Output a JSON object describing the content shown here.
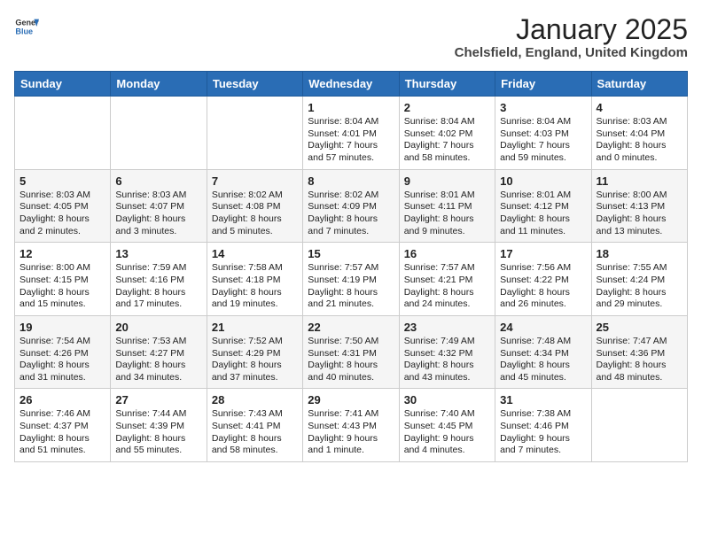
{
  "header": {
    "logo_general": "General",
    "logo_blue": "Blue",
    "title": "January 2025",
    "subtitle": "Chelsfield, England, United Kingdom"
  },
  "calendar": {
    "days_of_week": [
      "Sunday",
      "Monday",
      "Tuesday",
      "Wednesday",
      "Thursday",
      "Friday",
      "Saturday"
    ],
    "weeks": [
      [
        {
          "day": "",
          "content": ""
        },
        {
          "day": "",
          "content": ""
        },
        {
          "day": "",
          "content": ""
        },
        {
          "day": "1",
          "content": "Sunrise: 8:04 AM\nSunset: 4:01 PM\nDaylight: 7 hours and 57 minutes."
        },
        {
          "day": "2",
          "content": "Sunrise: 8:04 AM\nSunset: 4:02 PM\nDaylight: 7 hours and 58 minutes."
        },
        {
          "day": "3",
          "content": "Sunrise: 8:04 AM\nSunset: 4:03 PM\nDaylight: 7 hours and 59 minutes."
        },
        {
          "day": "4",
          "content": "Sunrise: 8:03 AM\nSunset: 4:04 PM\nDaylight: 8 hours and 0 minutes."
        }
      ],
      [
        {
          "day": "5",
          "content": "Sunrise: 8:03 AM\nSunset: 4:05 PM\nDaylight: 8 hours and 2 minutes."
        },
        {
          "day": "6",
          "content": "Sunrise: 8:03 AM\nSunset: 4:07 PM\nDaylight: 8 hours and 3 minutes."
        },
        {
          "day": "7",
          "content": "Sunrise: 8:02 AM\nSunset: 4:08 PM\nDaylight: 8 hours and 5 minutes."
        },
        {
          "day": "8",
          "content": "Sunrise: 8:02 AM\nSunset: 4:09 PM\nDaylight: 8 hours and 7 minutes."
        },
        {
          "day": "9",
          "content": "Sunrise: 8:01 AM\nSunset: 4:11 PM\nDaylight: 8 hours and 9 minutes."
        },
        {
          "day": "10",
          "content": "Sunrise: 8:01 AM\nSunset: 4:12 PM\nDaylight: 8 hours and 11 minutes."
        },
        {
          "day": "11",
          "content": "Sunrise: 8:00 AM\nSunset: 4:13 PM\nDaylight: 8 hours and 13 minutes."
        }
      ],
      [
        {
          "day": "12",
          "content": "Sunrise: 8:00 AM\nSunset: 4:15 PM\nDaylight: 8 hours and 15 minutes."
        },
        {
          "day": "13",
          "content": "Sunrise: 7:59 AM\nSunset: 4:16 PM\nDaylight: 8 hours and 17 minutes."
        },
        {
          "day": "14",
          "content": "Sunrise: 7:58 AM\nSunset: 4:18 PM\nDaylight: 8 hours and 19 minutes."
        },
        {
          "day": "15",
          "content": "Sunrise: 7:57 AM\nSunset: 4:19 PM\nDaylight: 8 hours and 21 minutes."
        },
        {
          "day": "16",
          "content": "Sunrise: 7:57 AM\nSunset: 4:21 PM\nDaylight: 8 hours and 24 minutes."
        },
        {
          "day": "17",
          "content": "Sunrise: 7:56 AM\nSunset: 4:22 PM\nDaylight: 8 hours and 26 minutes."
        },
        {
          "day": "18",
          "content": "Sunrise: 7:55 AM\nSunset: 4:24 PM\nDaylight: 8 hours and 29 minutes."
        }
      ],
      [
        {
          "day": "19",
          "content": "Sunrise: 7:54 AM\nSunset: 4:26 PM\nDaylight: 8 hours and 31 minutes."
        },
        {
          "day": "20",
          "content": "Sunrise: 7:53 AM\nSunset: 4:27 PM\nDaylight: 8 hours and 34 minutes."
        },
        {
          "day": "21",
          "content": "Sunrise: 7:52 AM\nSunset: 4:29 PM\nDaylight: 8 hours and 37 minutes."
        },
        {
          "day": "22",
          "content": "Sunrise: 7:50 AM\nSunset: 4:31 PM\nDaylight: 8 hours and 40 minutes."
        },
        {
          "day": "23",
          "content": "Sunrise: 7:49 AM\nSunset: 4:32 PM\nDaylight: 8 hours and 43 minutes."
        },
        {
          "day": "24",
          "content": "Sunrise: 7:48 AM\nSunset: 4:34 PM\nDaylight: 8 hours and 45 minutes."
        },
        {
          "day": "25",
          "content": "Sunrise: 7:47 AM\nSunset: 4:36 PM\nDaylight: 8 hours and 48 minutes."
        }
      ],
      [
        {
          "day": "26",
          "content": "Sunrise: 7:46 AM\nSunset: 4:37 PM\nDaylight: 8 hours and 51 minutes."
        },
        {
          "day": "27",
          "content": "Sunrise: 7:44 AM\nSunset: 4:39 PM\nDaylight: 8 hours and 55 minutes."
        },
        {
          "day": "28",
          "content": "Sunrise: 7:43 AM\nSunset: 4:41 PM\nDaylight: 8 hours and 58 minutes."
        },
        {
          "day": "29",
          "content": "Sunrise: 7:41 AM\nSunset: 4:43 PM\nDaylight: 9 hours and 1 minute."
        },
        {
          "day": "30",
          "content": "Sunrise: 7:40 AM\nSunset: 4:45 PM\nDaylight: 9 hours and 4 minutes."
        },
        {
          "day": "31",
          "content": "Sunrise: 7:38 AM\nSunset: 4:46 PM\nDaylight: 9 hours and 7 minutes."
        },
        {
          "day": "",
          "content": ""
        }
      ]
    ]
  }
}
